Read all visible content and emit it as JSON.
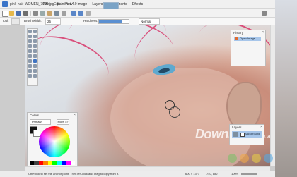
{
  "window": {
    "title": "pink-hair-WOMEN_7000.jpg - paint.net 4.0",
    "menus": [
      "File",
      "Edit",
      "View",
      "Image",
      "Layers",
      "Adjustments",
      "Effects"
    ],
    "controls": [
      "–",
      "□",
      "✕"
    ]
  },
  "toolbar": {
    "icons": [
      "new-icon",
      "open-icon",
      "save-icon",
      "print-icon",
      "cut-icon",
      "copy-icon",
      "paste-icon",
      "crop-icon",
      "deselect-icon",
      "undo-icon",
      "redo-icon",
      "grid-icon",
      "settings-icon"
    ]
  },
  "options": {
    "tool_label": "Tool:",
    "brush_width_label": "Brush width:",
    "brush_width_value": "25",
    "hardness_label": "Hardness:",
    "hardness_percent": 75,
    "blend_mode": "Normal"
  },
  "panels": {
    "tools_title": "Tools",
    "history": {
      "title": "History",
      "items": [
        "Open Image"
      ]
    },
    "layers": {
      "title": "Layers",
      "layer_name": "Background"
    },
    "colors": {
      "title": "Colors",
      "mode": "Primary",
      "more_label": "More >>",
      "palette": [
        "#000000",
        "#404040",
        "#ff0000",
        "#ff8000",
        "#ffff00",
        "#00ff00",
        "#00ffff",
        "#0000ff",
        "#ff00ff",
        "#ffffff"
      ]
    }
  },
  "canvas": {
    "watermark": "Download",
    "watermark_suffix": ".com.vn"
  },
  "status": {
    "hint": "Ctrl+click to set the anchor point. Then left-click and drag to copy from it.",
    "image_size": "600 × 1371",
    "selection": "740, 882",
    "zoom": "100%"
  },
  "colors_ui": {
    "accent": "#3f74c2",
    "hair": "#d8386a"
  }
}
